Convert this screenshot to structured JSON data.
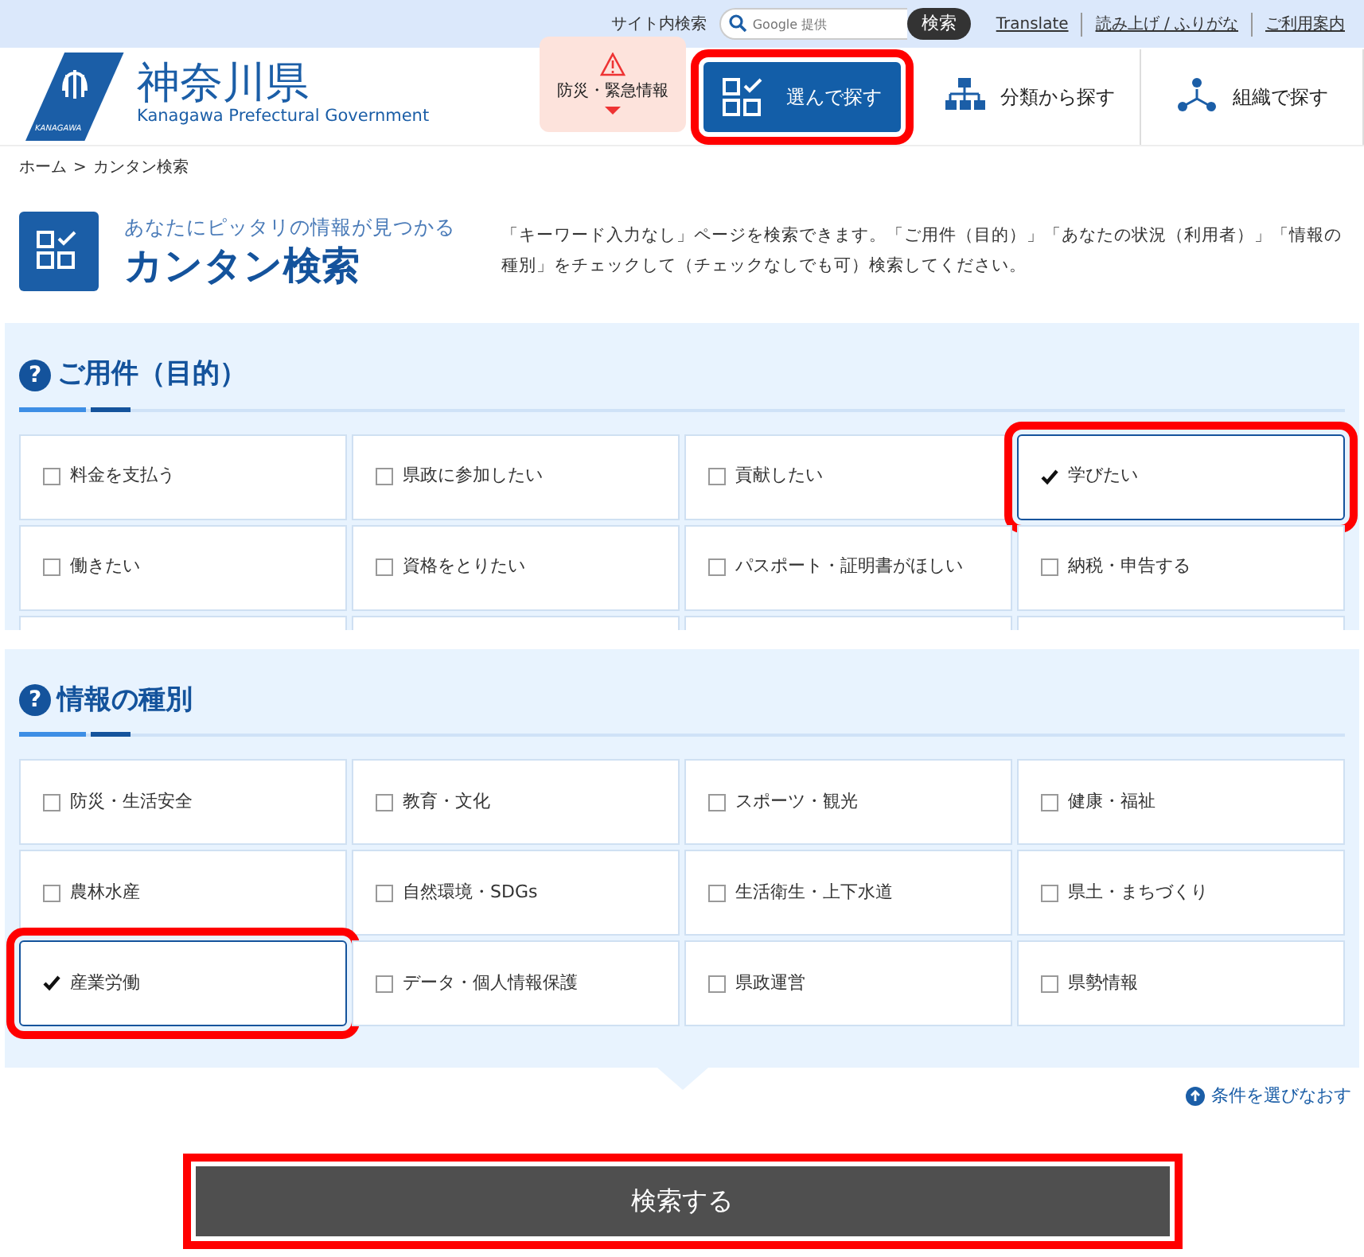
{
  "utility_bar": {
    "search_label": "サイト内検索",
    "search_placeholder": "Google 提供",
    "search_button": "検索",
    "links": [
      "Translate",
      "読み上げ / ふりがな",
      "ご利用案内"
    ]
  },
  "header": {
    "logo_title": "神奈川県",
    "logo_subtitle": "Kanagawa Prefectural Government",
    "logo_mark_text": "KANAGAWA",
    "nav": [
      {
        "kind": "alert",
        "label": "防災・緊急情報",
        "selected": false,
        "highlighted": false
      },
      {
        "kind": "choose",
        "label": "選んで探す",
        "selected": true,
        "highlighted": true
      },
      {
        "kind": "category",
        "label": "分類から探す",
        "selected": false,
        "highlighted": false
      },
      {
        "kind": "organization",
        "label": "組織で探す",
        "selected": false,
        "highlighted": false
      }
    ]
  },
  "breadcrumb": {
    "home": "ホーム",
    "separator": ">",
    "current": "カンタン検索"
  },
  "page_title": {
    "subtitle": "あなたにピッタリの情報が見つかる",
    "title": "カンタン検索",
    "description": "「キーワード入力なし」ページを検索できます。「ご用件（目的）」「あなたの状況（利用者）」「情報の種別」をチェックして（チェックなしでも可）検索してください。"
  },
  "sections": [
    {
      "icon": "?",
      "title": "ご用件（目的）",
      "cut_off": true,
      "options": [
        {
          "label": "料金を支払う",
          "checked": false,
          "highlighted": false
        },
        {
          "label": "県政に参加したい",
          "checked": false,
          "highlighted": false
        },
        {
          "label": "貢献したい",
          "checked": false,
          "highlighted": false
        },
        {
          "label": "学びたい",
          "checked": true,
          "highlighted": true
        },
        {
          "label": "働きたい",
          "checked": false,
          "highlighted": false
        },
        {
          "label": "資格をとりたい",
          "checked": false,
          "highlighted": false
        },
        {
          "label": "パスポート・証明書がほしい",
          "checked": false,
          "highlighted": false
        },
        {
          "label": "納税・申告する",
          "checked": false,
          "highlighted": false
        }
      ]
    },
    {
      "icon": "?",
      "title": "情報の種別",
      "cut_off": false,
      "options": [
        {
          "label": "防災・生活安全",
          "checked": false,
          "highlighted": false
        },
        {
          "label": "教育・文化",
          "checked": false,
          "highlighted": false
        },
        {
          "label": "スポーツ・観光",
          "checked": false,
          "highlighted": false
        },
        {
          "label": "健康・福祉",
          "checked": false,
          "highlighted": false
        },
        {
          "label": "農林水産",
          "checked": false,
          "highlighted": false
        },
        {
          "label": "自然環境・SDGs",
          "checked": false,
          "highlighted": false
        },
        {
          "label": "生活衛生・上下水道",
          "checked": false,
          "highlighted": false
        },
        {
          "label": "県土・まちづくり",
          "checked": false,
          "highlighted": false
        },
        {
          "label": "産業労働",
          "checked": true,
          "highlighted": true
        },
        {
          "label": "データ・個人情報保護",
          "checked": false,
          "highlighted": false
        },
        {
          "label": "県政運営",
          "checked": false,
          "highlighted": false
        },
        {
          "label": "県勢情報",
          "checked": false,
          "highlighted": false
        }
      ]
    }
  ],
  "reset_link": "条件を選びなおす",
  "submit": {
    "label": "検索する",
    "highlighted": true
  }
}
